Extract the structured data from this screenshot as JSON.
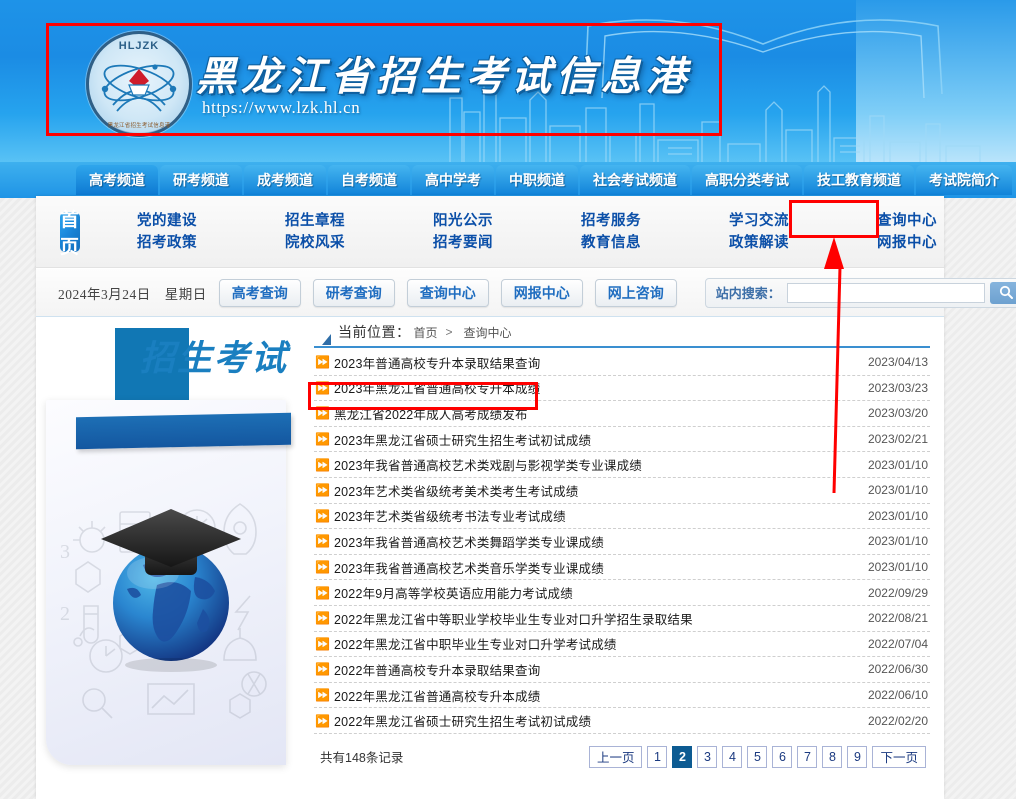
{
  "site": {
    "logo_text": "HLJZK",
    "logo_subtext": "黑龙江省招生考试信息港",
    "title": "黑龙江省招生考试信息港",
    "url": "https://www.lzk.hl.cn"
  },
  "tabs": [
    {
      "label": "高考频道",
      "active": true
    },
    {
      "label": "研考频道",
      "active": false
    },
    {
      "label": "成考频道",
      "active": false
    },
    {
      "label": "自考频道",
      "active": false
    },
    {
      "label": "高中学考",
      "active": false
    },
    {
      "label": "中职频道",
      "active": false
    },
    {
      "label": "社会考试频道",
      "active": false
    },
    {
      "label": "高职分类考试",
      "active": false
    },
    {
      "label": "技工教育频道",
      "active": false
    },
    {
      "label": "考试院简介",
      "active": false
    }
  ],
  "subnav": {
    "home_label": "首页",
    "columns": [
      {
        "top": "党的建设",
        "bottom": "招考政策"
      },
      {
        "top": "招生章程",
        "bottom": "院校风采"
      },
      {
        "top": "阳光公示",
        "bottom": "招考要闻"
      },
      {
        "top": "招考服务",
        "bottom": "教育信息"
      },
      {
        "top": "学习交流",
        "bottom": "政策解读"
      },
      {
        "top": "查询中心",
        "bottom": "网报中心"
      }
    ]
  },
  "toolbar": {
    "date": "2024年3月24日　星期日",
    "quick_buttons": [
      "高考查询",
      "研考查询",
      "查询中心",
      "网报中心",
      "网上咨询"
    ],
    "search_label": "站内搜索：",
    "search_value": "",
    "search_placeholder": "",
    "search_icon": "search-icon"
  },
  "breadcrumb": {
    "label": "当前位置：",
    "items": [
      "首页",
      "查询中心"
    ],
    "separator": ">"
  },
  "left_banner": {
    "tag_text": "招生考试"
  },
  "news": {
    "items": [
      {
        "title": "2023年普通高校专升本录取结果查询",
        "date": "2023/04/13",
        "highlighted": false
      },
      {
        "title": "2023年黑龙江省普通高校专升本成绩",
        "date": "2023/03/23",
        "highlighted": true
      },
      {
        "title": "黑龙江省2022年成人高考成绩发布",
        "date": "2023/03/20",
        "highlighted": false
      },
      {
        "title": "2023年黑龙江省硕士研究生招生考试初试成绩",
        "date": "2023/02/21",
        "highlighted": false
      },
      {
        "title": "2023年我省普通高校艺术类戏剧与影视学类专业课成绩",
        "date": "2023/01/10",
        "highlighted": false
      },
      {
        "title": "2023年艺术类省级统考美术类考生考试成绩",
        "date": "2023/01/10",
        "highlighted": false
      },
      {
        "title": "2023年艺术类省级统考书法专业考试成绩",
        "date": "2023/01/10",
        "highlighted": false
      },
      {
        "title": "2023年我省普通高校艺术类舞蹈学类专业课成绩",
        "date": "2023/01/10",
        "highlighted": false
      },
      {
        "title": "2023年我省普通高校艺术类音乐学类专业课成绩",
        "date": "2023/01/10",
        "highlighted": false
      },
      {
        "title": "2022年9月高等学校英语应用能力考试成绩",
        "date": "2022/09/29",
        "highlighted": false
      },
      {
        "title": "2022年黑龙江省中等职业学校毕业生专业对口升学招生录取结果",
        "date": "2022/08/21",
        "highlighted": false
      },
      {
        "title": "2022年黑龙江省中职毕业生专业对口升学考试成绩",
        "date": "2022/07/04",
        "highlighted": false
      },
      {
        "title": "2022年普通高校专升本录取结果查询",
        "date": "2022/06/30",
        "highlighted": false
      },
      {
        "title": "2022年黑龙江省普通高校专升本成绩",
        "date": "2022/06/10",
        "highlighted": false
      },
      {
        "title": "2022年黑龙江省硕士研究生招生考试初试成绩",
        "date": "2022/02/20",
        "highlighted": false
      }
    ]
  },
  "pagination": {
    "total_text": "共有148条记录",
    "prev_label": "上一页",
    "next_label": "下一页",
    "pages": [
      "1",
      "2",
      "3",
      "4",
      "5",
      "6",
      "7",
      "8",
      "9"
    ],
    "current": "2"
  },
  "annotations": {
    "accent_color": "#ff0000",
    "boxes": [
      "header-logo-box",
      "nav-query-center-box",
      "news-row-box"
    ],
    "arrow": "red-arrow"
  }
}
